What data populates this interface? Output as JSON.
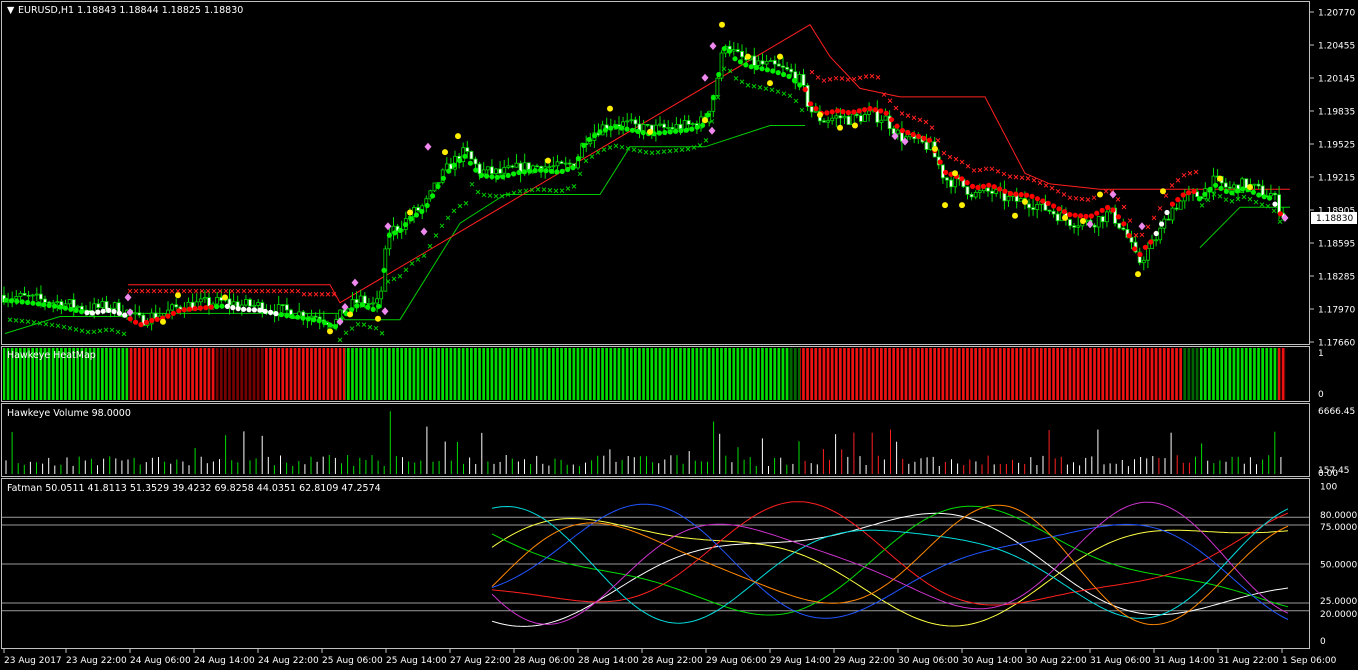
{
  "header": {
    "symbol_line": "EURUSD,H1  1.18843 1.18844 1.18825 1.18830",
    "current_price": "1.18830"
  },
  "colors": {
    "bull_dot": "#00ee00",
    "bear_dot": "#ff0000",
    "neutral_dot": "#ffffff",
    "cross_green": "#00cc00",
    "cross_red": "#ff2020",
    "signal_yellow": "#ffee00",
    "signal_violet": "#ee88ee",
    "heat_green": "#00dd00",
    "heat_red": "#ee1111",
    "heat_darkred": "#770000",
    "heat_darkgreen": "#006600"
  },
  "chart_data": [
    {
      "type": "candlestick",
      "pane": "main",
      "title": "EURUSD,H1",
      "ohlc_last": {
        "open": 1.18843,
        "high": 1.18844,
        "low": 1.18825,
        "close": 1.1883
      },
      "ylim": [
        1.1766,
        1.2077
      ],
      "yticks": [
        "1.20770",
        "1.20455",
        "1.20145",
        "1.19835",
        "1.19525",
        "1.19215",
        "1.18905",
        "1.18595",
        "1.18285",
        "1.17970",
        "1.17660"
      ],
      "xticks": [
        "23 Aug 2017",
        "23 Aug 22:00",
        "24 Aug 06:00",
        "24 Aug 14:00",
        "24 Aug 22:00",
        "25 Aug 06:00",
        "25 Aug 14:00",
        "27 Aug 22:00",
        "28 Aug 06:00",
        "28 Aug 14:00",
        "28 Aug 22:00",
        "29 Aug 06:00",
        "29 Aug 14:00",
        "29 Aug 22:00",
        "30 Aug 06:00",
        "30 Aug 14:00",
        "30 Aug 22:00",
        "31 Aug 06:00",
        "31 Aug 14:00",
        "31 Aug 22:00",
        "1 Sep 06:00"
      ],
      "close_path": [
        [
          0,
          1.181
        ],
        [
          30,
          1.1807
        ],
        [
          60,
          1.1803
        ],
        [
          90,
          1.1797
        ],
        [
          110,
          1.18
        ],
        [
          126,
          1.1795
        ],
        [
          130,
          1.1792
        ],
        [
          140,
          1.1786
        ],
        [
          150,
          1.179
        ],
        [
          165,
          1.1793
        ],
        [
          180,
          1.18
        ],
        [
          200,
          1.1802
        ],
        [
          225,
          1.1804
        ],
        [
          240,
          1.1801
        ],
        [
          260,
          1.18
        ],
        [
          280,
          1.1796
        ],
        [
          300,
          1.1793
        ],
        [
          320,
          1.179
        ],
        [
          335,
          1.1784
        ],
        [
          345,
          1.1796
        ],
        [
          360,
          1.1806
        ],
        [
          375,
          1.18
        ],
        [
          380,
          1.1805
        ],
        [
          388,
          1.187
        ],
        [
          400,
          1.1875
        ],
        [
          412,
          1.1887
        ],
        [
          425,
          1.1895
        ],
        [
          440,
          1.192
        ],
        [
          452,
          1.1935
        ],
        [
          465,
          1.1945
        ],
        [
          480,
          1.1927
        ],
        [
          500,
          1.1925
        ],
        [
          520,
          1.193
        ],
        [
          540,
          1.1932
        ],
        [
          560,
          1.193
        ],
        [
          575,
          1.1935
        ],
        [
          585,
          1.1958
        ],
        [
          600,
          1.1968
        ],
        [
          615,
          1.1973
        ],
        [
          630,
          1.197
        ],
        [
          650,
          1.1966
        ],
        [
          670,
          1.1968
        ],
        [
          690,
          1.197
        ],
        [
          705,
          1.1975
        ],
        [
          715,
          1.2005
        ],
        [
          725,
          1.205
        ],
        [
          735,
          1.2037
        ],
        [
          748,
          1.203
        ],
        [
          760,
          1.2028
        ],
        [
          775,
          1.2025
        ],
        [
          790,
          1.202
        ],
        [
          800,
          1.2012
        ],
        [
          810,
          1.1985
        ],
        [
          822,
          1.1975
        ],
        [
          838,
          1.1978
        ],
        [
          850,
          1.1976
        ],
        [
          870,
          1.198
        ],
        [
          885,
          1.1977
        ],
        [
          900,
          1.196
        ],
        [
          915,
          1.1955
        ],
        [
          930,
          1.195
        ],
        [
          945,
          1.192
        ],
        [
          960,
          1.1915
        ],
        [
          975,
          1.1905
        ],
        [
          990,
          1.1908
        ],
        [
          1010,
          1.19
        ],
        [
          1030,
          1.1898
        ],
        [
          1050,
          1.189
        ],
        [
          1070,
          1.188
        ],
        [
          1090,
          1.1878
        ],
        [
          1110,
          1.1888
        ],
        [
          1125,
          1.187
        ],
        [
          1138,
          1.184
        ],
        [
          1150,
          1.1855
        ],
        [
          1160,
          1.187
        ],
        [
          1170,
          1.189
        ],
        [
          1185,
          1.1902
        ],
        [
          1200,
          1.1905
        ],
        [
          1215,
          1.1918
        ],
        [
          1230,
          1.191
        ],
        [
          1245,
          1.1915
        ],
        [
          1260,
          1.1908
        ],
        [
          1272,
          1.1905
        ],
        [
          1285,
          1.1883
        ]
      ],
      "trail_green": [
        [
          5,
          1.1774
        ],
        [
          60,
          1.179
        ],
        [
          125,
          1.179
        ],
        [
          130,
          1.1793
        ],
        [
          240,
          1.1793
        ],
        [
          340,
          1.1793
        ],
        [
          345,
          1.1787
        ],
        [
          400,
          1.1787
        ],
        [
          460,
          1.1878
        ],
        [
          505,
          1.1905
        ],
        [
          600,
          1.1905
        ],
        [
          630,
          1.195
        ],
        [
          705,
          1.195
        ],
        [
          770,
          1.197
        ],
        [
          805,
          1.197
        ]
      ],
      "trail_red": [
        [
          128,
          1.182
        ],
        [
          330,
          1.182
        ],
        [
          340,
          1.1803
        ],
        [
          810,
          1.2065
        ],
        [
          830,
          1.2035
        ],
        [
          860,
          1.2005
        ],
        [
          900,
          1.1997
        ],
        [
          985,
          1.1997
        ],
        [
          1025,
          1.1925
        ],
        [
          1050,
          1.1915
        ],
        [
          1100,
          1.191
        ],
        [
          1190,
          1.191
        ],
        [
          1290,
          1.191
        ]
      ],
      "trail_green2": [
        [
          1200,
          1.1855
        ],
        [
          1240,
          1.1893
        ],
        [
          1290,
          1.1893
        ]
      ]
    },
    {
      "type": "bar",
      "pane": "heatmap",
      "title": "Hawkeye HeatMap",
      "ylim": [
        0,
        1
      ],
      "yticks": [
        "1",
        "0"
      ],
      "segments": [
        {
          "x0": 3,
          "x1": 128,
          "color": "green"
        },
        {
          "x0": 128,
          "x1": 215,
          "color": "red"
        },
        {
          "x0": 215,
          "x1": 265,
          "color": "darkred"
        },
        {
          "x0": 265,
          "x1": 345,
          "color": "red"
        },
        {
          "x0": 345,
          "x1": 790,
          "color": "green"
        },
        {
          "x0": 790,
          "x1": 800,
          "color": "darkgreen"
        },
        {
          "x0": 800,
          "x1": 1183,
          "color": "red"
        },
        {
          "x0": 1183,
          "x1": 1200,
          "color": "darkgreen"
        },
        {
          "x0": 1200,
          "x1": 1278,
          "color": "green"
        },
        {
          "x0": 1278,
          "x1": 1286,
          "color": "red"
        }
      ]
    },
    {
      "type": "bar",
      "pane": "volume",
      "title": "Hawkeye Volume 98.0000",
      "ylim": [
        0,
        6666.45
      ],
      "yticks": [
        "6666.45",
        "157.45",
        "0.00"
      ]
    },
    {
      "type": "line",
      "pane": "oscillator",
      "title": "Fatman 50.0511 41.8113 51.3529 39.4232 69.8258 44.0351 62.8109 47.2574",
      "ylim": [
        0,
        100
      ],
      "yticks": [
        "100",
        "80.0000",
        "75.0000",
        "50.0000",
        "25.0000",
        "20.0000",
        "0"
      ],
      "levels": [
        80,
        75,
        50,
        25,
        20
      ]
    }
  ]
}
